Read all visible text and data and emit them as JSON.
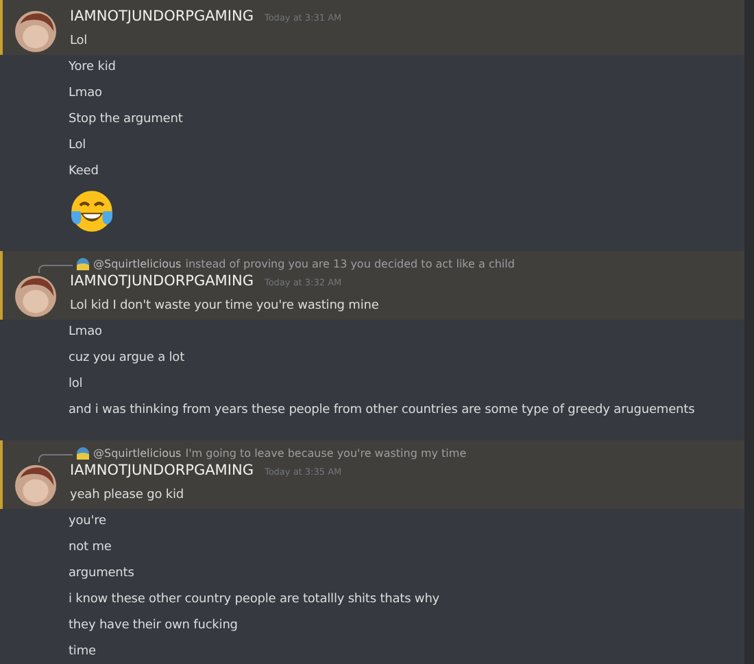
{
  "messages": [
    {
      "mentioned": true,
      "author": "IAMNOTJUNDORPGAMING",
      "timestamp": "Today at 3:31 AM",
      "lines": [
        {
          "kind": "text",
          "text": "Lol"
        },
        {
          "kind": "text",
          "text": "Yore kid"
        },
        {
          "kind": "text",
          "text": "Lmao"
        },
        {
          "kind": "text",
          "text": "Stop the argument"
        },
        {
          "kind": "text",
          "text": "Lol"
        },
        {
          "kind": "text",
          "text": "Keed"
        },
        {
          "kind": "emoji"
        }
      ]
    },
    {
      "reply": {
        "user": "@Squirtlelicious",
        "text": "instead of proving you are 13 you decided to act like a child"
      },
      "mentioned": true,
      "author": "IAMNOTJUNDORPGAMING",
      "timestamp": "Today at 3:32 AM",
      "lines": [
        {
          "kind": "text",
          "text": "Lol kid I don't waste your time you're wasting mine"
        },
        {
          "kind": "text",
          "text": "Lmao"
        },
        {
          "kind": "text",
          "text": "cuz you argue a lot"
        },
        {
          "kind": "text",
          "text": "lol"
        },
        {
          "kind": "text",
          "text": "and i was thinking from years these people from other countries are some type of greedy aruguements"
        }
      ]
    },
    {
      "reply": {
        "user": "@Squirtlelicious",
        "text": "I'm going to leave because you're wasting my time"
      },
      "mentioned": true,
      "author": "IAMNOTJUNDORPGAMING",
      "timestamp": "Today at 3:35 AM",
      "lines": [
        {
          "kind": "text",
          "text": "yeah please go kid"
        },
        {
          "kind": "text",
          "text": "you're"
        },
        {
          "kind": "text",
          "text": "not me"
        },
        {
          "kind": "text",
          "text": "arguments"
        },
        {
          "kind": "text",
          "text": "i know these other country people are totallly shits thats why"
        },
        {
          "kind": "text",
          "text": "they have their own fucking"
        },
        {
          "kind": "text",
          "text": "time"
        }
      ]
    }
  ]
}
